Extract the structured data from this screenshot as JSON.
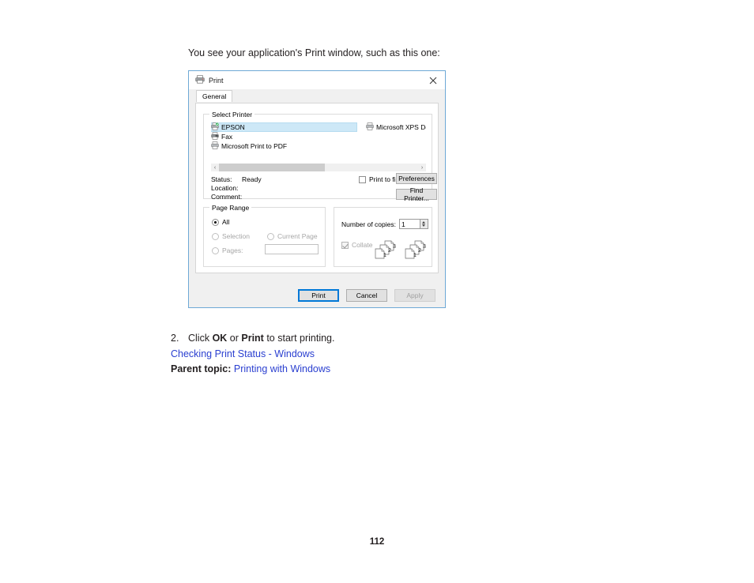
{
  "page": {
    "intro": "You see your application's Print window, such as this one:",
    "page_number": "112"
  },
  "steps": {
    "number": "2.",
    "text_before": "Click ",
    "bold_1": "OK",
    "text_middle": " or ",
    "bold_2": "Print",
    "text_after": " to start printing.",
    "link_checking_status": "Checking Print Status - Windows",
    "parent_label": "Parent topic:",
    "parent_link": "Printing with Windows",
    "link_color": "#2a3fd0"
  },
  "dialog": {
    "title": "Print",
    "title_icon": "printer-icon",
    "close_icon": "close-icon",
    "tab": "General",
    "border_color": "#6ea9d6",
    "select_printer": {
      "group_title": "Select Printer",
      "printers": [
        {
          "name": "EPSON",
          "icon": "printer-default-icon",
          "selected": true
        },
        {
          "name": "Fax",
          "icon": "fax-icon",
          "selected": false
        },
        {
          "name": "Microsoft Print to PDF",
          "icon": "printer-icon",
          "selected": false
        }
      ],
      "second_column": {
        "name": "Microsoft XPS Documen",
        "icon": "printer-icon"
      },
      "scroll_left_icon": "chevron-left-icon",
      "scroll_right_icon": "chevron-right-icon",
      "status_label": "Status:",
      "status_value": "Ready",
      "location_label": "Location:",
      "location_value": "",
      "comment_label": "Comment:",
      "comment_value": "",
      "print_to_file_label": "Print to file",
      "print_to_file_checked": false,
      "preferences_button": "Preferences",
      "find_printer_button": "Find Printer..."
    },
    "page_range": {
      "group_title": "Page Range",
      "all_label": "All",
      "all_selected": true,
      "selection_label": "Selection",
      "selection_disabled": true,
      "current_page_label": "Current Page",
      "current_page_disabled": true,
      "pages_label": "Pages:",
      "pages_disabled": true,
      "pages_value": ""
    },
    "copies": {
      "number_label": "Number of copies:",
      "number_value": "1",
      "collate_label": "Collate",
      "collate_checked": true,
      "collate_disabled": true,
      "collate_page_numbers": [
        "1",
        "2",
        "3"
      ]
    },
    "footer": {
      "print_button": "Print",
      "cancel_button": "Cancel",
      "apply_button": "Apply",
      "apply_disabled": true,
      "default_focus_color": "#0078d7"
    }
  }
}
